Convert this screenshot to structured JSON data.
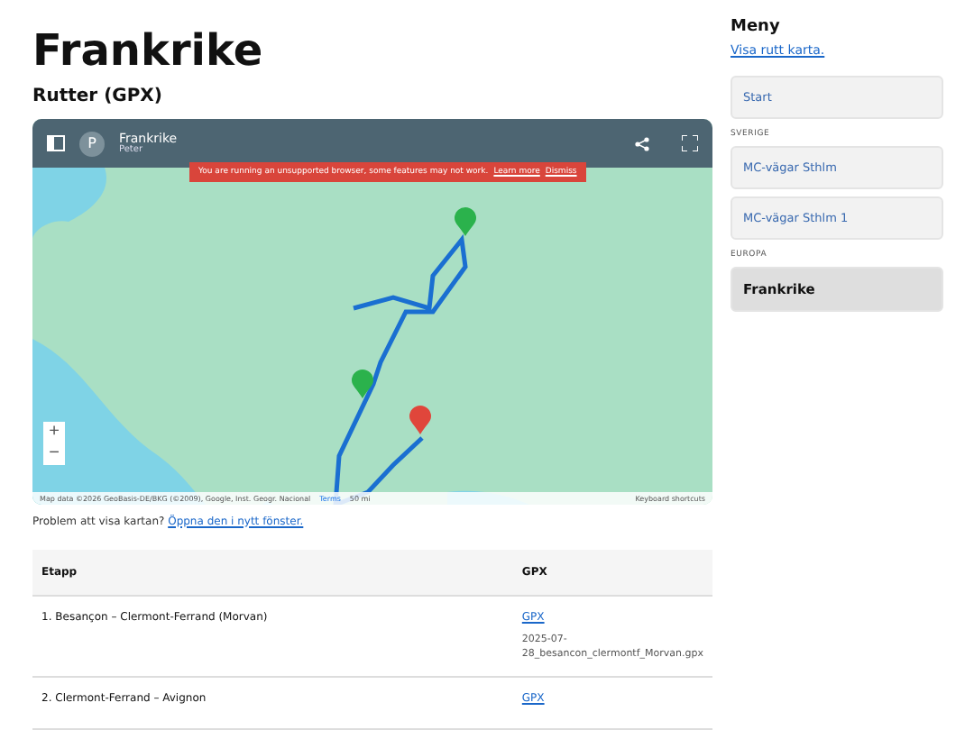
{
  "page": {
    "title": "Frankrike",
    "subtitle": "Rutter (GPX)"
  },
  "map": {
    "title": "Frankrike",
    "owner": "Peter",
    "avatar": "P",
    "banner": {
      "text": "You are running an unsupported browser, some features may not work.",
      "learn": "Learn more",
      "dismiss": "Dismiss"
    },
    "zoom_in": "+",
    "zoom_out": "−",
    "attribution": "Map data ©2026 GeoBasis-DE/BKG (©2009), Google, Inst. Geogr. Nacional",
    "terms": "Terms",
    "scale": "50 mi",
    "shortcuts": "Keyboard shortcuts"
  },
  "problem": {
    "text": "Problem att visa kartan?",
    "link": "Öppna den i nytt fönster."
  },
  "table": {
    "columns": [
      "Etapp",
      "GPX"
    ],
    "rows": [
      {
        "etapp": "1. Besançon – Clermont-Ferrand (Morvan)",
        "link": "GPX",
        "file": "2025-07-28_besancon_clermontf_Morvan.gpx"
      },
      {
        "etapp": "2. Clermont-Ferrand – Avignon",
        "link": "GPX"
      }
    ]
  },
  "sidebar": {
    "title": "Meny",
    "link": "Visa rutt karta.",
    "items": [
      {
        "kind": "item",
        "label": "Start",
        "selected": false
      },
      {
        "kind": "heading",
        "label": "SVERIGE"
      },
      {
        "kind": "item",
        "label": "MC-vägar Sthlm",
        "selected": false
      },
      {
        "kind": "item",
        "label": "MC-vägar Sthlm 1",
        "selected": false
      },
      {
        "kind": "heading",
        "label": "EUROPA"
      },
      {
        "kind": "item",
        "label": "Frankrike",
        "selected": true
      }
    ]
  }
}
